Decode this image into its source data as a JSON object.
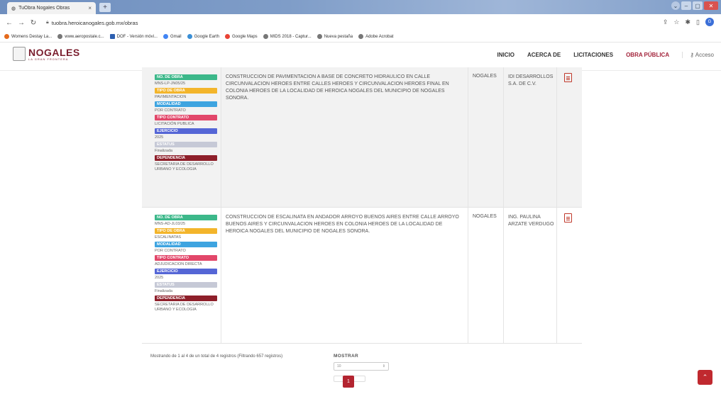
{
  "browser": {
    "tab_title": "TuObra Nogales Obras",
    "tab_close": "×",
    "new_tab": "+",
    "url": "tuobra.heroicanogales.gob.mx/obras",
    "bookmarks": [
      "Womens Destay La...",
      "www.aeropostale.c...",
      "DOF - Versión móvi...",
      "Gmail",
      "Google Earth",
      "Google Maps",
      "MIDS 2018 - Captur...",
      "Nueva pestaña",
      "Adobe Acrobat"
    ],
    "avatar_letter": "G"
  },
  "site": {
    "logo_name": "NOGALES",
    "logo_sub": "LA GRAN FRONTERA",
    "menu": {
      "inicio": "INICIO",
      "acerca": "ACERCA DE",
      "licitaciones": "LICITACIONES",
      "obra_publica": "OBRA PÚBLICA",
      "acceso": "Acceso"
    }
  },
  "labels": {
    "no_obra": "NO. DE OBRA",
    "tipo_obra": "TIPO DE OBRA",
    "modalidad": "MODALIDAD",
    "tipo_contrato": "TIPO CONTRATO",
    "ejercicio": "EJERCICIO",
    "estatus": "ESTATUS",
    "dependencia": "DEPENDENCIA"
  },
  "rows": [
    {
      "no_obra": "MNS-LP-JN05/25",
      "tipo_obra": "PAVIMENTACION",
      "modalidad": "POR CONTRATO",
      "tipo_contrato": "LICITACIÓN PUBLICA",
      "ejercicio": "2025",
      "estatus": "Finalizada",
      "dependencia": "SECRETARIA DE DESARROLLO URBANO Y ECOLOGIA",
      "descripcion": "CONSTRUCCION DE PAVIMENTACION A BASE DE CONCRETO HIDRAULICO EN CALLE CIRCUNVALACION HEROES ENTRE CALLES HEROES Y CIRCUNVALACION HEROES FINAL EN COLONIA HEROES DE LA LOCALIDAD DE HEROICA NOGALES DEL MUNICIPIO DE NOGALES SONORA.",
      "localidad": "NOGALES",
      "contratista": "IDI DESARROLLOS S.A. DE C.V."
    },
    {
      "no_obra": "MNS-AD-JL03/25",
      "tipo_obra": "ESCALINATAS",
      "modalidad": "POR CONTRATO",
      "tipo_contrato": "ADJUDICACION DIRECTA",
      "ejercicio": "2025",
      "estatus": "Finalizada",
      "dependencia": "SECRETARIA DE DESARROLLO URBANO Y ECOLOGIA",
      "descripcion": "CONSTRUCCION DE ESCALINATA EN ANDADOR ARROYO BUENOS AIRES ENTRE CALLE ARROYO BUENOS AIRES Y CIRCUNVALACION HEROES EN COLONIA HEROES DE LA LOCALIDAD DE HEROICA NOGALES DEL MUNICIPIO DE NOGALES SONORA.",
      "localidad": "NOGALES",
      "contratista": "ING. PAULINA ARZATE VERDUGO"
    }
  ],
  "footer": {
    "info": "Mostrando de 1 al 4 de un total de 4 registros (Filtrando 657 registros)",
    "mostrar": "MOSTRAR",
    "select_value": "10",
    "page": "1"
  },
  "colors": {
    "brand": "#a3243b",
    "no_obra": "#3cb88a",
    "tipo_obra": "#f3b52b",
    "modalidad": "#3ea4e0",
    "tipo_contrato": "#e2476a",
    "ejercicio": "#5566d6",
    "estatus": "#c6c9d6",
    "dependencia": "#8e1f2a"
  }
}
